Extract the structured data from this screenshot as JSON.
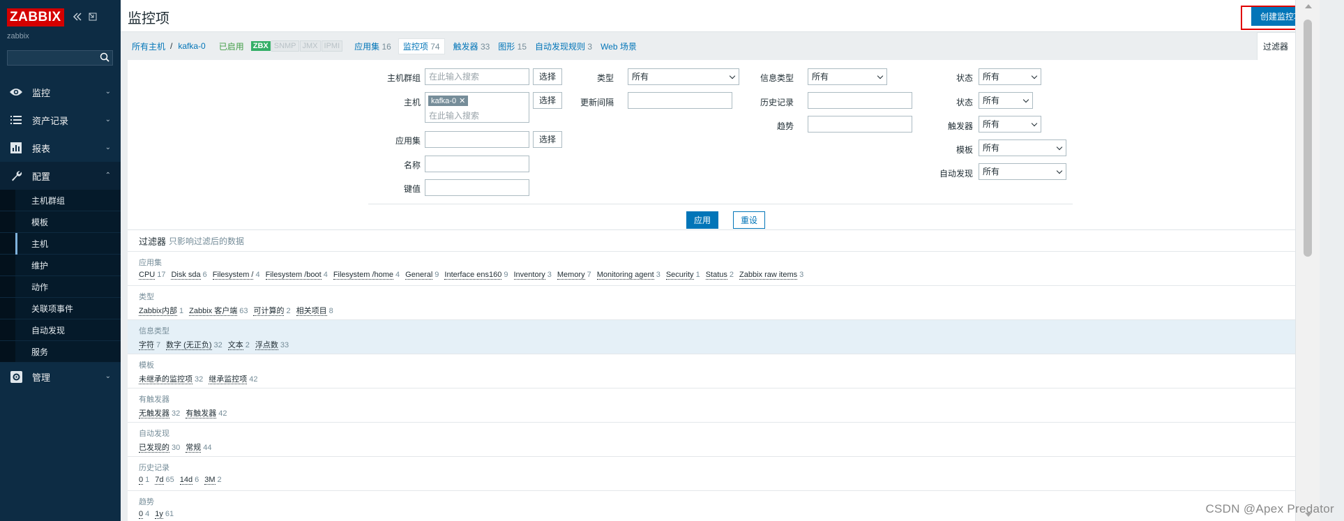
{
  "sidebar": {
    "logo": "ZABBIX",
    "instance": "zabbix",
    "search_placeholder": "",
    "menu": [
      {
        "label": "监控",
        "icon": "eye-icon"
      },
      {
        "label": "资产记录",
        "icon": "list-icon"
      },
      {
        "label": "报表",
        "icon": "bar-chart-icon"
      },
      {
        "label": "配置",
        "icon": "wrench-icon"
      }
    ],
    "submenu": [
      "主机群组",
      "模板",
      "主机",
      "维护",
      "动作",
      "关联项事件",
      "自动发现",
      "服务"
    ],
    "admin": {
      "label": "管理",
      "icon": "gear-icon"
    }
  },
  "header": {
    "title": "监控项",
    "create_button": "创建监控项"
  },
  "tabs": {
    "crumb_all_hosts": "所有主机",
    "crumb_sep": "/",
    "crumb_host": "kafka-0",
    "status": "已启用",
    "avail": [
      "ZBX",
      "SNMP",
      "JMX",
      "IPMI"
    ],
    "links": [
      {
        "label": "应用集",
        "count": "16"
      },
      {
        "label": "监控项",
        "count": "74"
      },
      {
        "label": "触发器",
        "count": "33"
      },
      {
        "label": "图形",
        "count": "15"
      },
      {
        "label": "自动发现规则",
        "count": "3"
      },
      {
        "label": "Web 场景",
        "count": ""
      }
    ],
    "filter_tab": "过滤器"
  },
  "filter": {
    "host_group_label": "主机群组",
    "host_group_placeholder": "在此输入搜索",
    "host_label": "主机",
    "host_chip": "kafka-0",
    "host_placeholder": "在此输入搜索",
    "app_label": "应用集",
    "name_label": "名称",
    "key_label": "键值",
    "select_btn": "选择",
    "type_label": "类型",
    "type_value": "所有",
    "interval_label": "更新间隔",
    "info_type_label": "信息类型",
    "info_type_value": "所有",
    "history_label": "历史记录",
    "trends_label": "趋势",
    "state_label": "状态",
    "state_value": "所有",
    "status_label": "状态",
    "status_value": "所有",
    "triggers_label": "触发器",
    "triggers_value": "所有",
    "template_label": "模板",
    "template_value": "所有",
    "discovery_label": "自动发现",
    "discovery_value": "所有",
    "apply_btn": "应用",
    "reset_btn": "重设"
  },
  "subfilter": {
    "title": "过滤器",
    "note": "只影响过滤后的数据",
    "groups": [
      {
        "title": "应用集",
        "items": [
          {
            "label": "CPU",
            "count": "17"
          },
          {
            "label": "Disk sda",
            "count": "6"
          },
          {
            "label": "Filesystem /",
            "count": "4"
          },
          {
            "label": "Filesystem /boot",
            "count": "4"
          },
          {
            "label": "Filesystem /home",
            "count": "4"
          },
          {
            "label": "General",
            "count": "9"
          },
          {
            "label": "Interface ens160",
            "count": "9"
          },
          {
            "label": "Inventory",
            "count": "3"
          },
          {
            "label": "Memory",
            "count": "7"
          },
          {
            "label": "Monitoring agent",
            "count": "3"
          },
          {
            "label": "Security",
            "count": "1"
          },
          {
            "label": "Status",
            "count": "2"
          },
          {
            "label": "Zabbix raw items",
            "count": "3"
          }
        ]
      },
      {
        "title": "类型",
        "items": [
          {
            "label": "Zabbix内部",
            "count": "1"
          },
          {
            "label": "Zabbix 客户端",
            "count": "63"
          },
          {
            "label": "可计算的",
            "count": "2"
          },
          {
            "label": "相关项目",
            "count": "8"
          }
        ]
      },
      {
        "title": "信息类型",
        "items": [
          {
            "label": "字符",
            "count": "7"
          },
          {
            "label": "数字 (无正负)",
            "count": "32"
          },
          {
            "label": "文本",
            "count": "2"
          },
          {
            "label": "浮点数",
            "count": "33"
          }
        ]
      },
      {
        "title": "模板",
        "items": [
          {
            "label": "未继承的监控项",
            "count": "32"
          },
          {
            "label": "继承监控项",
            "count": "42"
          }
        ]
      },
      {
        "title": "有触发器",
        "items": [
          {
            "label": "无触发器",
            "count": "32"
          },
          {
            "label": "有触发器",
            "count": "42"
          }
        ]
      },
      {
        "title": "自动发现",
        "items": [
          {
            "label": "已发现的",
            "count": "30"
          },
          {
            "label": "常规",
            "count": "44"
          }
        ]
      },
      {
        "title": "历史记录",
        "items": [
          {
            "label": "0",
            "count": "1"
          },
          {
            "label": "7d",
            "count": "65"
          },
          {
            "label": "14d",
            "count": "6"
          },
          {
            "label": "3M",
            "count": "2"
          }
        ]
      },
      {
        "title": "趋势",
        "items": [
          {
            "label": "0",
            "count": "4"
          },
          {
            "label": "1y",
            "count": "61"
          }
        ]
      }
    ]
  },
  "watermark": "CSDN @Apex    Predator"
}
